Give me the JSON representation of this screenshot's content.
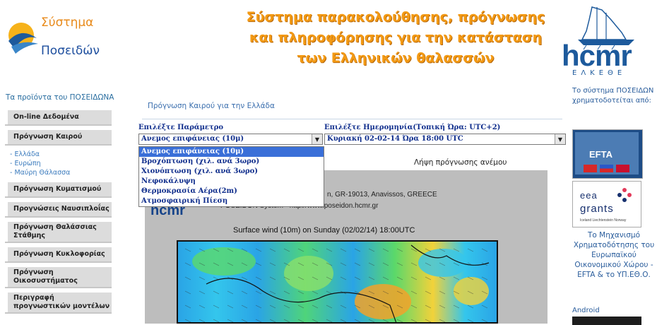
{
  "header": {
    "logo_line1": "Σύστημα",
    "logo_line2": "Ποσειδών",
    "title_line1": "Σύστημα παρακολούθησης, πρόγνωσης",
    "title_line2": "και πληροφόρησης για την κατάσταση",
    "title_line3": "των Ελληνικών θαλασσών",
    "hcmr_logo": "hcmr",
    "hcmr_sub": "ΕΛΚΕΘΕ"
  },
  "sidebar": {
    "title": "Τα προϊόντα του ΠΟΣΕΙΔΩΝΑ",
    "items": [
      {
        "label": "On-line Δεδομένα"
      },
      {
        "label": "Πρόγνωση Καιρού"
      },
      {
        "label": "Πρόγνωση Κυματισμού"
      },
      {
        "label": "Προγνώσεις Ναυσιπλοΐας"
      },
      {
        "label": "Πρόγνωση Θαλάσσιας Στάθμης"
      },
      {
        "label": "Πρόγνωση Κυκλοφορίας"
      },
      {
        "label": "Πρόγνωση Οικοσυστήματος"
      },
      {
        "label": "Περιγραφή προγνωστικών μοντέλων"
      }
    ],
    "sub_items": [
      "- Ελλάδα",
      "- Ευρώπη",
      "- Μαύρη Θάλασσα"
    ]
  },
  "main": {
    "title": "Πρόγνωση Καιρού για την Ελλάδα",
    "param_label": "Επιλέξτε Παράμετρο",
    "param_selected": "Ανεμος επιφάνειας (10μ)",
    "param_options": [
      "Ανεμος επιφάνειας (10μ)",
      "Βροχόπτωση (χιλ. ανά 3ωρο)",
      "Χιονόπτωση (χιλ. ανά 3ωρο)",
      "Νεφοκάλυψη",
      "Θερμοκρασία Αέρα(2m)",
      "Ατμοσφαιρική Πίεση"
    ],
    "date_label": "Επιλέξτε Ημερομηνία(Τοπική Ώρα: UTC+2)",
    "date_selected": "Κυριακή 02-02-14 Ώρα 18:00 UTC",
    "wind_link": "Λήψη πρόγνωσης ανέμου",
    "map": {
      "hcmr": "hcmr",
      "address": "n, GR-19013, Anavissos, GREECE",
      "system": "POSEIDON System - http://www.poseidon.hcmr.gr",
      "caption": "Surface wind (10m) on Sunday (02/02/14) 18:00UTC"
    }
  },
  "right": {
    "funding_text": "Το σύστημα ΠΟΣΕΙΔΩΝ χρηματοδοτείται από:",
    "efta_label": "EFTA",
    "eea_line1": "eea",
    "eea_line2": "grants",
    "eea_line3": "Iceland Liechtenstein Norway",
    "mechanism_text": "Το Μηχανισμό Χρηματοδότησης του Ευρωπαϊκού Οικονομικού Χώρου - EFTA & το ΥΠ.ΕΘ.Ο.",
    "android": "Android"
  },
  "colors": {
    "header_title": "#f39a14",
    "link_blue": "#3b6fae",
    "nav_bg": "#dcdcdc",
    "select_text": "#0f2d8c",
    "dropdown_highlight": "#3a6fd8"
  }
}
